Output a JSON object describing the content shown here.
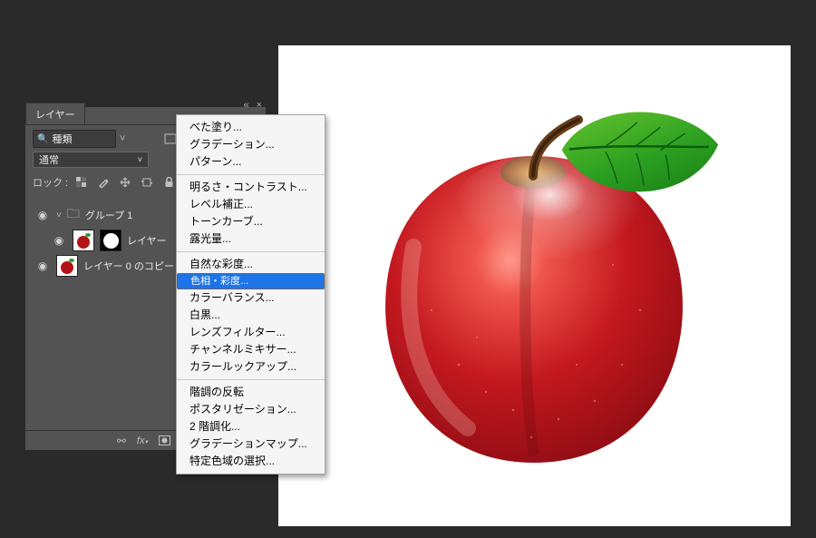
{
  "panel": {
    "title": "レイヤー",
    "search_label": "種類",
    "blend_mode": "通常",
    "lock_label": "ロック :",
    "layers": [
      {
        "name": "グループ 1",
        "kind": "group"
      },
      {
        "name": "レイヤー",
        "kind": "masked"
      },
      {
        "name": "レイヤー 0 のコピー",
        "kind": "normal"
      }
    ]
  },
  "context_menu": {
    "groups": [
      [
        "べた塗り...",
        "グラデーション...",
        "パターン..."
      ],
      [
        "明るさ・コントラスト...",
        "レベル補正...",
        "トーンカーブ...",
        "露光量..."
      ],
      [
        "自然な彩度...",
        "色相・彩度...",
        "カラーバランス...",
        "白黒...",
        "レンズフィルター...",
        "チャンネルミキサー...",
        "カラールックアップ..."
      ],
      [
        "階調の反転",
        "ポスタリゼーション...",
        "2 階調化...",
        "グラデーションマップ...",
        "特定色域の選択..."
      ]
    ],
    "highlighted": "色相・彩度..."
  }
}
